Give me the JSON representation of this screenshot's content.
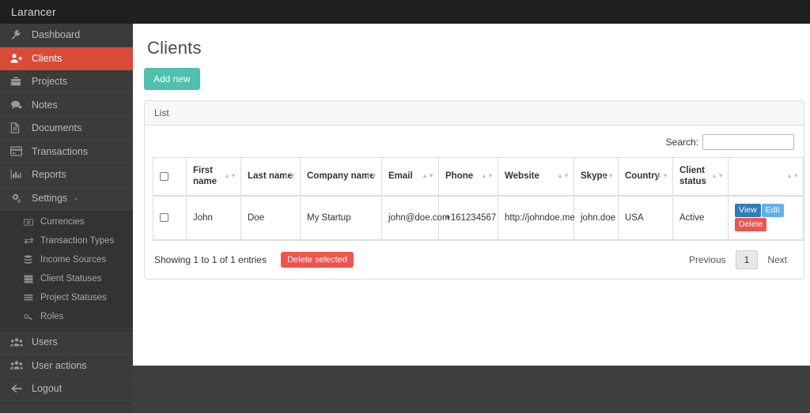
{
  "topbar": {
    "brand": "Larancer"
  },
  "sidebar": {
    "items": [
      {
        "label": "Dashboard",
        "icon": "wrench-icon",
        "active": false
      },
      {
        "label": "Clients",
        "icon": "user-plus-icon",
        "active": true
      },
      {
        "label": "Projects",
        "icon": "briefcase-icon",
        "active": false
      },
      {
        "label": "Notes",
        "icon": "comment-icon",
        "active": false
      },
      {
        "label": "Documents",
        "icon": "file-icon",
        "active": false
      },
      {
        "label": "Transactions",
        "icon": "credit-card-icon",
        "active": false
      },
      {
        "label": "Reports",
        "icon": "bar-chart-icon",
        "active": false
      },
      {
        "label": "Settings",
        "icon": "gears-icon",
        "active": false,
        "caret": "⌄"
      }
    ],
    "settings_submenu": [
      {
        "label": "Currencies",
        "icon": "money-icon"
      },
      {
        "label": "Transaction Types",
        "icon": "exchange-icon"
      },
      {
        "label": "Income Sources",
        "icon": "database-icon"
      },
      {
        "label": "Client Statuses",
        "icon": "list-alt-icon"
      },
      {
        "label": "Project Statuses",
        "icon": "list-icon"
      },
      {
        "label": "Roles",
        "icon": "key-icon"
      }
    ],
    "bottom_items": [
      {
        "label": "Users",
        "icon": "users-icon"
      },
      {
        "label": "User actions",
        "icon": "users-icon"
      },
      {
        "label": "Logout",
        "icon": "arrow-left-icon"
      }
    ]
  },
  "main": {
    "page_title": "Clients",
    "add_new_label": "Add new",
    "panel_title": "List",
    "search": {
      "label": "Search:",
      "value": "",
      "placeholder": ""
    },
    "table": {
      "columns": [
        {
          "label": "",
          "key": "check",
          "sortable": false
        },
        {
          "label": "First name",
          "key": "first_name",
          "sortable": true
        },
        {
          "label": "Last name",
          "key": "last_name",
          "sortable": true
        },
        {
          "label": "Company name",
          "key": "company_name",
          "sortable": true
        },
        {
          "label": "Email",
          "key": "email",
          "sortable": true
        },
        {
          "label": "Phone",
          "key": "phone",
          "sortable": true
        },
        {
          "label": "Website",
          "key": "website",
          "sortable": true
        },
        {
          "label": "Skype",
          "key": "skype",
          "sortable": true
        },
        {
          "label": "Country",
          "key": "country",
          "sortable": true
        },
        {
          "label": "Client status",
          "key": "client_status",
          "sortable": true
        },
        {
          "label": "",
          "key": "actions",
          "sortable": true
        }
      ],
      "rows": [
        {
          "first_name": "John",
          "last_name": "Doe",
          "company_name": "My Startup",
          "email": "john@doe.com",
          "phone": "+161234567",
          "website": "http://johndoe.me",
          "skype": "john.doe",
          "country": "USA",
          "client_status": "Active",
          "actions": {
            "view": "View",
            "edit": "Edit",
            "delete": "Delete"
          }
        }
      ]
    },
    "footer": {
      "showing": "Showing 1 to 1 of 1 entries",
      "delete_selected_label": "Delete selected",
      "previous_label": "Previous",
      "page_number": "1",
      "next_label": "Next"
    }
  },
  "colors": {
    "topbar_bg": "#1f1f1f",
    "sidebar_bg": "#3b3b3b",
    "active_nav": "#d94a38",
    "accent_teal": "#4ec0ad",
    "danger_red": "#f1544f",
    "view_blue": "#2f7dbd",
    "edit_blue": "#61b0ee",
    "page_bg": "#3e3e3e"
  }
}
